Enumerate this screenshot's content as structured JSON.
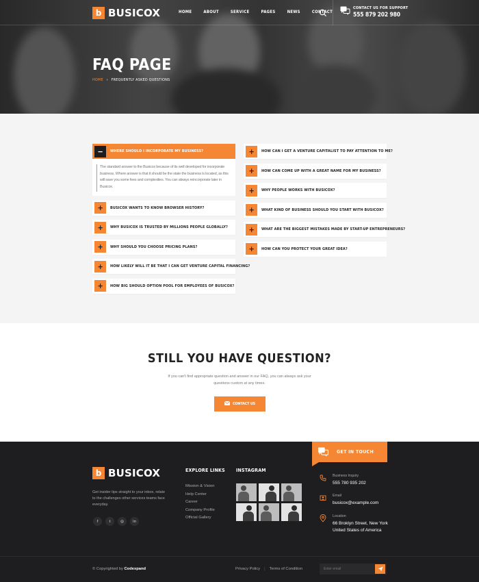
{
  "brand": {
    "name": "BUSICOX",
    "mark": "b",
    "accent": "#f58634",
    "dark": "#1e1e20"
  },
  "nav": [
    "HOME",
    "ABOUT",
    "SERVICE",
    "PAGES",
    "NEWS",
    "CONTACT"
  ],
  "support": {
    "label": "CONTACT US FOR SUPPORT",
    "phone": "555 879 202 980"
  },
  "hero": {
    "title": "FAQ PAGE",
    "breadcrumb_home": "HOME",
    "breadcrumb_sep": "›",
    "breadcrumb_current": "FREQUENTLY ASKED QUESTIONS"
  },
  "faq_left": [
    {
      "q": "WHERE SHOULD I INCORPORATE MY BUSINESS?",
      "icon": "−",
      "active": true
    },
    {
      "q": "BUSICOX WANTS TO KNOW BROWSER HISTORY?",
      "icon": "+"
    },
    {
      "q": "WHY BUSICOX IS TRUSTED BY MILLIONS PEOPLE GLOBALLY?",
      "icon": "+"
    },
    {
      "q": "WHY SHOULD YOU CHOOSE PRICING PLANS?",
      "icon": "+"
    },
    {
      "q": "HOW LIKELY WILL IT BE THAT I CAN GET VENTURE CAPITAL FINANCING?",
      "icon": "+"
    },
    {
      "q": "HOW BIG SHOULD OPTION POOL FOR EMPLOYEES OF BUSICOX?",
      "icon": "+"
    }
  ],
  "faq_answer": "The standard answer to the Busicox because of its well developed for incorporate business. Where answer is that it should be the state the business is located, as this will save you some fees and complexities. You can always reincorporate later in Busicox.",
  "faq_right": [
    {
      "q": "HOW CAN I GET A VENTURE CAPITALIST TO PAY ATTENTION TO ME?",
      "icon": "+"
    },
    {
      "q": "HOW CAN COME UP WITH A GREAT NAME FOR MY BUSINESS?",
      "icon": "+"
    },
    {
      "q": "WHY PEOPLE WORKS WITH BUSICOX?",
      "icon": "+"
    },
    {
      "q": "WHAT KIND OF BUSINESS SHOULD YOU START WITH BUSICOX?",
      "icon": "+"
    },
    {
      "q": "WHAT ARE THE BIGGEST MISTAKES MADE BY START-UP ENTREPRENEURS?",
      "icon": "+"
    },
    {
      "q": "HOW CAN YOU PROTECT YOUR GREAT IDEA?",
      "icon": "+"
    }
  ],
  "still": {
    "title": "STILL YOU HAVE QUESTION?",
    "desc": "If you can't find appropriate question and answer in our FAQ, you can always ask your questions custom at any times.",
    "button": "CONTACT US"
  },
  "footer": {
    "get_in_touch": "GET IN TOUCH",
    "about": "Get insider tips straight to your inbox, relate to the challenges other services teams face everyday.",
    "socials": [
      "f",
      "t",
      "◎",
      "in"
    ],
    "explore_title": "EXPLORE LINKS",
    "explore": [
      "Mission & Vision",
      "Help Center",
      "Career",
      "Company Profile",
      "Official Gallery"
    ],
    "instagram_title": "INSTAGRAM",
    "contacts": [
      {
        "label": "Business Inquiry",
        "value": "555 780 935 202",
        "icon": "phone-icon"
      },
      {
        "label": "Email",
        "value": "busicox@example.com",
        "icon": "email-icon"
      },
      {
        "label": "Location",
        "value": "66 Broklyn Street, New York United States of America",
        "icon": "location-icon"
      }
    ],
    "copyright_prefix": "© Copyrighted by",
    "copyright_brand": "Codexpand",
    "privacy": "Privacy Policy",
    "sep": "|",
    "terms": "Terms of Condition",
    "email_placeholder": "Enter email"
  }
}
